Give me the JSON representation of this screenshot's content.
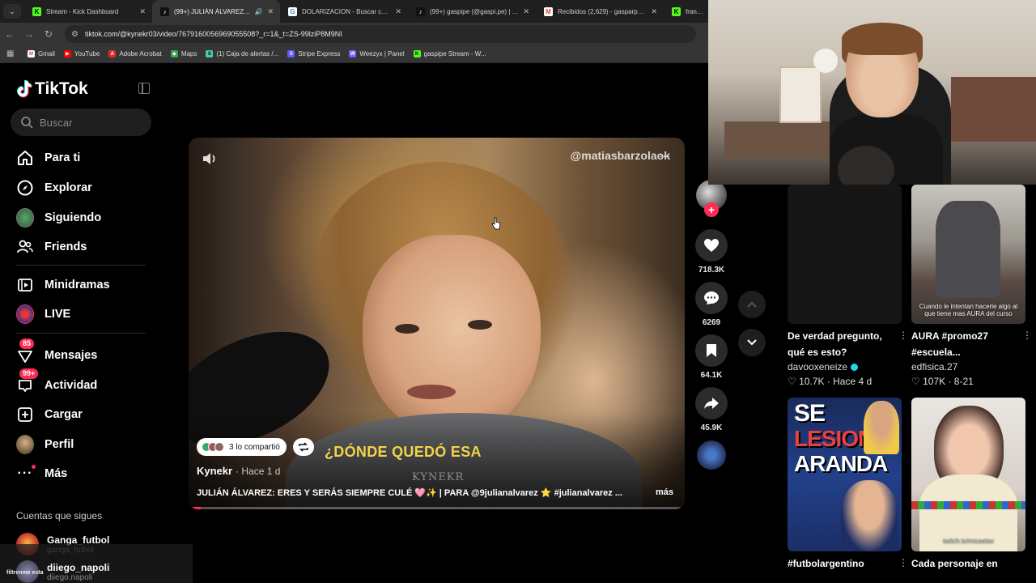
{
  "browser": {
    "tabs": [
      {
        "title": "Stream - Kick Dashboard",
        "color": "#53fc18",
        "glyph": "K"
      },
      {
        "title": "(99+) JULIÁN ÁLVAREZ: ERES",
        "color": "#111111",
        "glyph": "♪",
        "active": true
      },
      {
        "title": "DOLARIZACION - Buscar con G",
        "color": "#4285f4",
        "glyph": "G"
      },
      {
        "title": "(99+) gaspipe (@gaspi.pe) | Tik",
        "color": "#111111",
        "glyph": "♪"
      },
      {
        "title": "Recibidos (2,629) - gasparpenn",
        "color": "#ea4335",
        "glyph": "M"
      },
      {
        "title": "fransobri",
        "color": "#53fc18",
        "glyph": "K"
      }
    ],
    "url": "tiktok.com/@kynekr03/video/7679160056969055508?_r=1&_t=ZS-99lziP8M9NI",
    "bookmarks": [
      {
        "label": "Gmail",
        "color": "#ea4335",
        "glyph": "M"
      },
      {
        "label": "YouTube",
        "color": "#ff0000",
        "glyph": "▶"
      },
      {
        "label": "Adobe Acrobat",
        "color": "#d32f2f",
        "glyph": "A"
      },
      {
        "label": "Maps",
        "color": "#34a853",
        "glyph": "◆"
      },
      {
        "label": "(1) Caja de alertas /...",
        "color": "#4ec9b0",
        "glyph": "S"
      },
      {
        "label": "Stripe Express",
        "color": "#635bff",
        "glyph": "S"
      },
      {
        "label": "Weezyx | Panel",
        "color": "#7a5cff",
        "glyph": "W"
      },
      {
        "label": "gaspipe Stream - W...",
        "color": "#53fc18",
        "glyph": "K"
      }
    ]
  },
  "sidebar": {
    "logo": "TikTok",
    "search_placeholder": "Buscar",
    "nav": [
      {
        "label": "Para ti",
        "icon": "home-icon"
      },
      {
        "label": "Explorar",
        "icon": "compass-icon"
      },
      {
        "label": "Siguiendo",
        "icon": "following-avatar-icon"
      },
      {
        "label": "Friends",
        "icon": "friends-icon"
      },
      {
        "label": "Minidramas",
        "icon": "film-icon"
      },
      {
        "label": "LIVE",
        "icon": "live-icon"
      },
      {
        "label": "Mensajes",
        "icon": "messages-icon",
        "badge": "85"
      },
      {
        "label": "Actividad",
        "icon": "activity-icon",
        "badge": "99+"
      },
      {
        "label": "Cargar",
        "icon": "upload-icon"
      },
      {
        "label": "Perfil",
        "icon": "profile-icon"
      },
      {
        "label": "Más",
        "icon": "more-icon"
      }
    ],
    "following_title": "Cuentas que sigues",
    "following": [
      {
        "name": "Ganga_futbol",
        "handle": "ganga_futbol"
      },
      {
        "name": "diiego_napoli",
        "handle": "diiego.napoli"
      }
    ],
    "chat_overlay": "filtrenme esta"
  },
  "video": {
    "watermark": "@matiasbarzolaok",
    "caption_overlay": "¿DÓNDE QUEDÓ ESA",
    "overlay_brand": "KYNEKR",
    "shared_label": "3 lo compartió",
    "author": "Kynekr",
    "time": "· Hace 1 d",
    "description": "JULIÁN ÁLVAREZ: ERES Y SERÁS SIEMPRE CULÉ 🩷✨ | PARA @9julianalvarez ⭐ #julianalvarez ...",
    "more_label": "más"
  },
  "actions": {
    "likes": "718.3K",
    "comments": "6269",
    "saves": "64.1K",
    "shares": "45.9K"
  },
  "feed": [
    {
      "title": "De verdad pregunto, qué es esto?",
      "author": "davooxeneize",
      "verified": true,
      "meta": "♡ 10.7K · Hace 4 d",
      "thumb_caption": ""
    },
    {
      "title": "AURA #promo27 #escuela...",
      "author": "edfisica.27",
      "verified": false,
      "meta": "♡ 107K · 8-21",
      "thumb_caption": "Cuando le intentan hacerle algo al que tiene mas AURA del curso"
    },
    {
      "title": "#futbolargentino",
      "author": "",
      "verified": false,
      "meta": "",
      "thumb_text_1": "SE",
      "thumb_text_2": "LESIONÓ",
      "thumb_text_3": "ARANDA"
    },
    {
      "title": "Cada personaje en",
      "author": "",
      "verified": false,
      "meta": "",
      "thumb_caption": "twitch.tv/micaelax"
    }
  ]
}
